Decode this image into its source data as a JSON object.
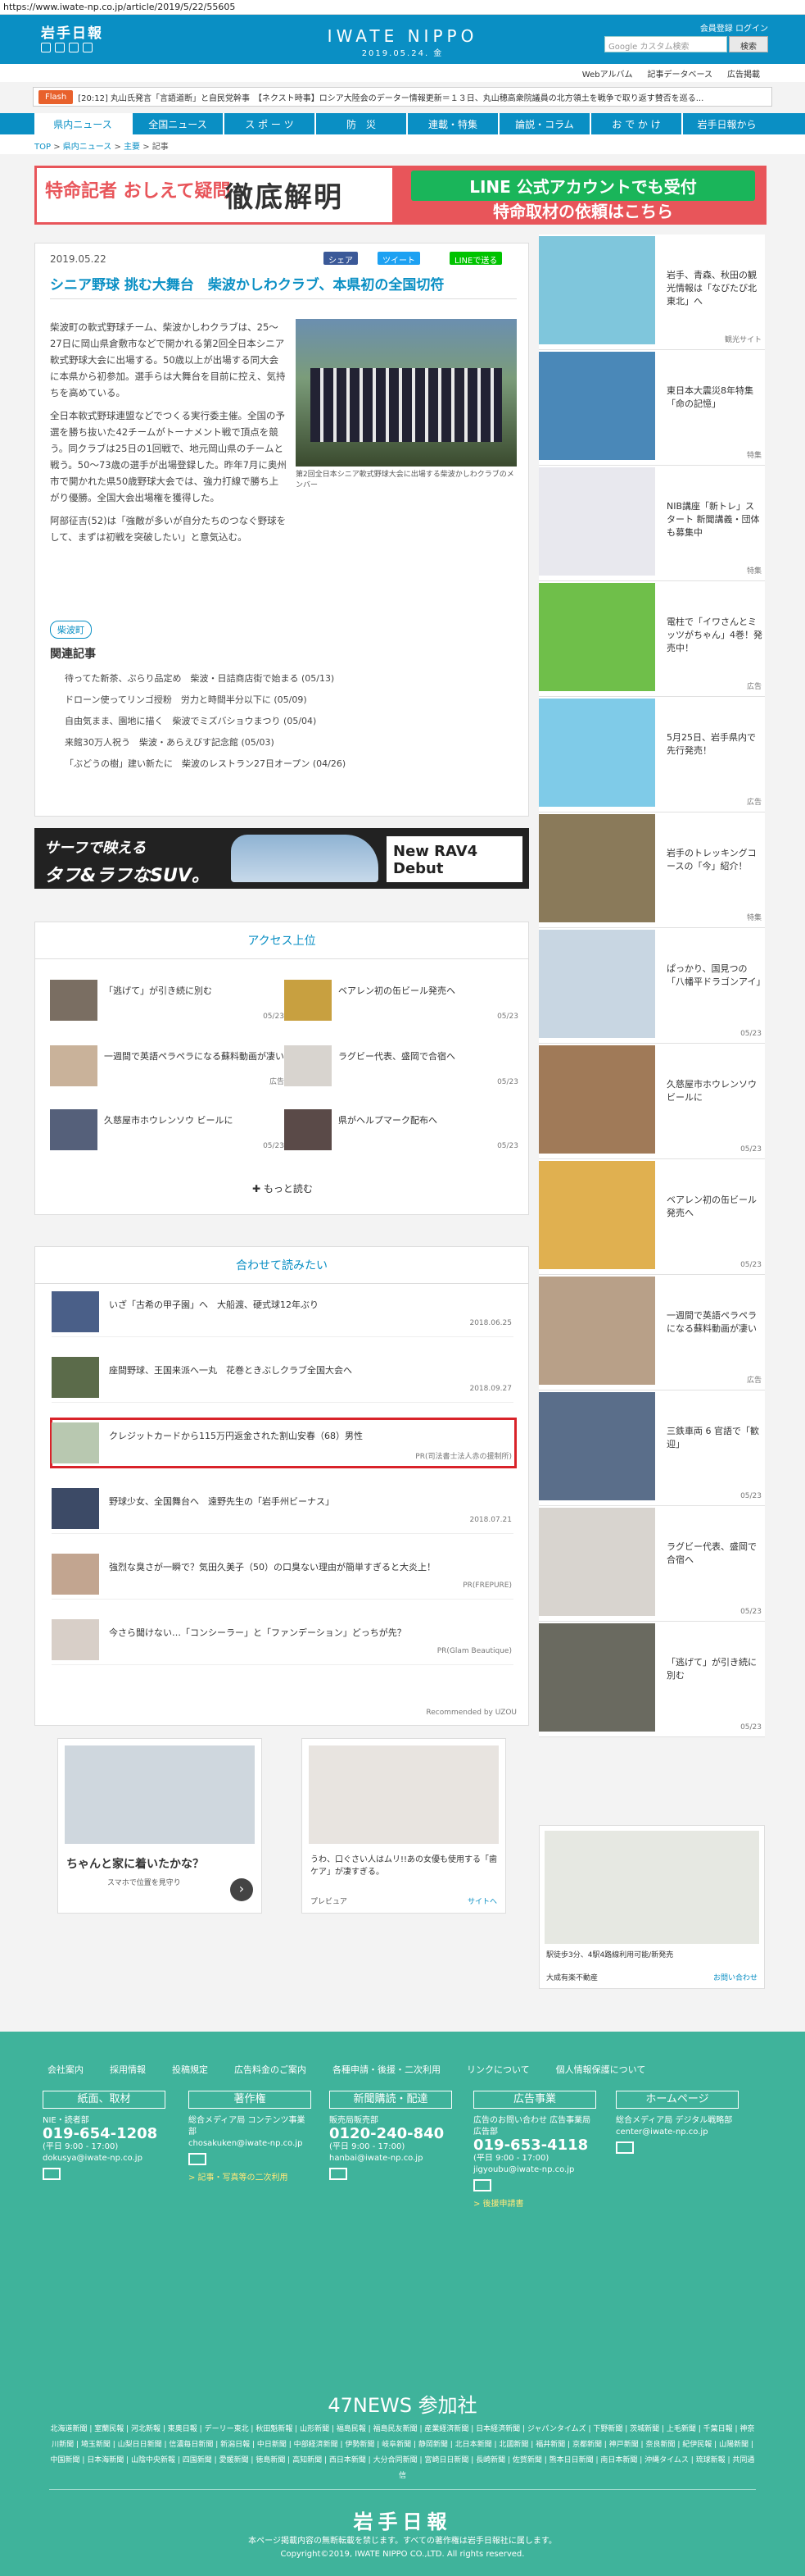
{
  "url": "https://www.iwate-np.co.jp/article/2019/5/22/55605",
  "header": {
    "logo": "岩手日報",
    "brand": "IWATE NIPPO",
    "date": "2019.05.24. 金",
    "links": "会員登録  ログイン",
    "search_placeholder": "Google カスタム検索",
    "search_button": "検索"
  },
  "subnav": [
    "Webアルバム",
    "記事データベース",
    "広告掲載"
  ],
  "flash": {
    "label": "Flash",
    "text": "[20:12] 丸山氏発言「言語道断」と自民党幹事　【ネクスト時事】ロシア大陸会のデーター情報更新＝１３日、丸山穂高衆院議員の北方領土を戦争で取り返す賛否を巡る..."
  },
  "gnav": [
    "県内ニュース",
    "全国ニュース",
    "ス ポ ー ツ",
    "防　災",
    "連載・特集",
    "論説・コラム",
    "お で か け",
    "岩手日報から"
  ],
  "breadcrumb": {
    "top": "TOP",
    "sep": " > ",
    "c1": "県内ニュース",
    "c2": "主要",
    "c3": "記事"
  },
  "banner": {
    "a": "特命記者 おしえて疑問",
    "b": "徹底解明",
    "c": "LINE 公式アカウントでも受付",
    "d": "特命取材の依頼はこちら"
  },
  "article": {
    "date": "2019.05.22",
    "share": "シェア",
    "tweet": "ツイート",
    "line": "LINEで送る",
    "title": "シニア野球 挑む大舞台　柴波かしわクラブ、本県初の全国切符",
    "p1": "柴波町の軟式野球チーム、柴波かしわクラブは、25〜27日に岡山県倉敷市などで開かれる第2回全日本シニア軟式野球大会に出場する。50歳以上が出場する同大会に本県から初参加。選手らは大舞台を目前に控え、気持ちを高めている。",
    "p2": "全日本軟式野球連盟などでつくる実行委主催。全国の予選を勝ち抜いた42チームがトーナメント戦で頂点を競う。同クラブは25日の1回戦で、地元岡山県のチームと戦う。50〜73歳の選手が出場登録した。昨年7月に奥州市で開かれた県50歳野球大会では、強力打線で勝ち上がり優勝。全国大会出場権を獲得した。",
    "p3": "阿部征吉(52)は「強敵が多いが自分たちのつなぐ野球をして、まずは初戦を突破したい」と意気込む。",
    "caption": "第2回全日本シニア軟式野球大会に出場する柴波かしわクラブのメンバー",
    "tag": "柴波町",
    "related_head": "関連記事",
    "related": [
      "待ってた新茶、ぷらり品定め　柴波・日詰商店街で始まる (05/13)",
      "ドローン使ってリンゴ授粉　労力と時間半分以下に (05/09)",
      "自由気まま、園地に描く　柴波でミズバショウまつり (05/04)",
      "来館30万人祝う　柴波・あらえびす記念館 (05/03)",
      "「ぶどうの樹」建い新たに　柴波のレストラン27日オープン (04/26)"
    ]
  },
  "ad2": {
    "t1": "サーフで映える",
    "t2": "タフ&ラフなSUV。",
    "rav": "New RAV4 Debut"
  },
  "ranking": {
    "head": "アクセス上位",
    "more": "もっと読む",
    "items": [
      {
        "t": "「逃げて」が引き続に別む",
        "d": "05/23"
      },
      {
        "t": "ベアレン初の缶ビール発売へ",
        "d": "05/23"
      },
      {
        "t": "一週間で英語ペラペラになる蘇料動画が凄い",
        "d": "広告"
      },
      {
        "t": "ラグビー代表、盛岡で合宿へ",
        "d": "05/23"
      },
      {
        "t": "久慈屋市ホウレンソウ ビールに",
        "d": "05/23"
      },
      {
        "t": "県がヘルプマーク配布へ",
        "d": "05/23"
      }
    ]
  },
  "recommend": {
    "head": "合わせて読みたい",
    "footer": "Recommended by UZOU",
    "items": [
      {
        "t": "いざ「古希の甲子園」へ　大船渡、硬式球12年ぶり",
        "d": "2018.06.25"
      },
      {
        "t": "座間野球、王国来派へ一丸　花巻ときぶしクラブ全国大会へ",
        "d": "2018.09.27"
      },
      {
        "t": "クレジットカードから115万円返金された割山安春（68）男性",
        "d": "PR(司法書士法人赤の援制所)"
      },
      {
        "t": "野球少女、全国舞台へ　遠野先生の「岩手州ビーナス」",
        "d": "2018.07.21"
      },
      {
        "t": "強烈な臭さが一瞬で？気田久美子（50）の口臭ない理由が簡単すぎると大炎上！",
        "d": "PR(FREPURE)"
      },
      {
        "t": "今さら聞けない…「コンシーラー」と「ファンデーション」どっちが先？",
        "d": "PR(Glam Beautique)"
      }
    ]
  },
  "ad3": {
    "t": "ちゃんと家に着いたかな？",
    "sub": "スマホで位置を見守り",
    "ad4": "うわ、口ぐさい人はムリ!!あの女優も使用する「歯ケア」が凄すぎる。",
    "pre": "プレビュア",
    "site": "サイトへ"
  },
  "sidebar": [
    {
      "t": "岩手、青森、秋田の観光情報は「なびたび北東北」へ",
      "d": "観光サイト"
    },
    {
      "t": "東日本大震災8年特集「命の記憶」",
      "d": "特集"
    },
    {
      "t": "NIB講座「新トレ」スタート 新聞講義・団体も募集中",
      "d": "特集"
    },
    {
      "t": "電柱で「イワさんとミッツがちゃん」4巻！発売中！",
      "d": "広告"
    },
    {
      "t": "5月25日、岩手県内で先行発売！",
      "d": "広告"
    },
    {
      "t": "岩手のトレッキングコースの「今」紹介！",
      "d": "特集"
    },
    {
      "t": "ぱっかり、国見つの「八幡平ドラゴンアイ」",
      "d": "05/23"
    },
    {
      "t": "久慈屋市ホウレンソウ ビールに",
      "d": "05/23"
    },
    {
      "t": "ベアレン初の缶ビール発売へ",
      "d": "05/23"
    },
    {
      "t": "一週間で英語ペラペラになる蘇料動画が凄い",
      "d": "広告"
    },
    {
      "t": "三鉄車両 6 官語で「歓迎」",
      "d": "05/23"
    },
    {
      "t": "ラグビー代表、盛岡で合宿へ",
      "d": "05/23"
    },
    {
      "t": "「逃げて」が引き続に別む",
      "d": "05/23"
    }
  ],
  "side_ad": {
    "t": "駅徒歩3分、4駅4路線利用可能/新発売",
    "brand": "大成有楽不動産",
    "link": "お問い合わせ"
  },
  "footer": {
    "links": [
      "会社案内",
      "採用情報",
      "投稿規定",
      "広告料金のご案内",
      "各種申請・後援・二次利用",
      "リンクについて",
      "個人情報保護について"
    ],
    "cols": [
      {
        "h": "紙面、取材",
        "l1": "NIE・読者部",
        "ph": "019-654-1208",
        "hrs": "(平日 9:00 - 17:00)",
        "mail": "dokusya@iwate-np.co.jp"
      },
      {
        "h": "著作権",
        "l1": "総合メディア局 コンテンツ事業部",
        "ph": "",
        "hrs": "",
        "mail": "chosakuken@iwate-np.co.jp",
        "extra": "> 記事・写真等の二次利用"
      },
      {
        "h": "新聞購読・配達",
        "l1": "販売局販売部",
        "ph": "0120-240-840",
        "hrs": "(平日 9:00 - 17:00)",
        "mail": "hanbai@iwate-np.co.jp"
      },
      {
        "h": "広告事業",
        "l1": "広告のお問い合わせ 広告事業局広告部",
        "ph": "019-653-4118",
        "hrs": "(平日 9:00 - 17:00)",
        "mail": "jigyoubu@iwate-np.co.jp",
        "extra": "> 後援申請書"
      },
      {
        "h": "ホームページ",
        "l1": "総合メディア局 デジタル戦略部",
        "ph": "",
        "hrs": "",
        "mail": "center@iwate-np.co.jp"
      }
    ],
    "news47": "47NEWS 参加社",
    "partners": "北海道新聞 | 室蘭民報 | 河北新報 | 東奥日報 | デーリー東北 | 秋田魁新報 | 山形新聞 | 福島民報 | 福島民友新聞 | 産業経済新聞 | 日本経済新聞 | ジャパンタイムズ | 下野新聞 | 茨城新聞 | 上毛新聞 | 千葉日報 | 神奈川新聞 | 埼玉新聞 | 山梨日日新聞 | 信濃毎日新聞 | 新潟日報 | 中日新聞 | 中部経済新聞 | 伊勢新聞 | 岐阜新聞 | 静岡新聞 | 北日本新聞 | 北國新聞 | 福井新聞 | 京都新聞 | 神戸新聞 | 奈良新聞 | 紀伊民報 | 山陽新聞 | 中国新聞 | 日本海新聞 | 山陰中央新報 | 四国新聞 | 愛媛新聞 | 徳島新聞 | 高知新聞 | 西日本新聞 | 大分合同新聞 | 宮崎日日新聞 | 長崎新聞 | 佐賀新聞 | 熊本日日新聞 | 南日本新聞 | 沖縄タイムス | 琉球新報 | 共同通信",
    "logo": "岩手日報",
    "copy1": "本ページ掲載内容の無断転載を禁じます。すべての著作権は岩手日報社に属します。",
    "copy2": "Copyright©2019, IWATE NIPPO CO.,LTD. All rights reserved."
  }
}
